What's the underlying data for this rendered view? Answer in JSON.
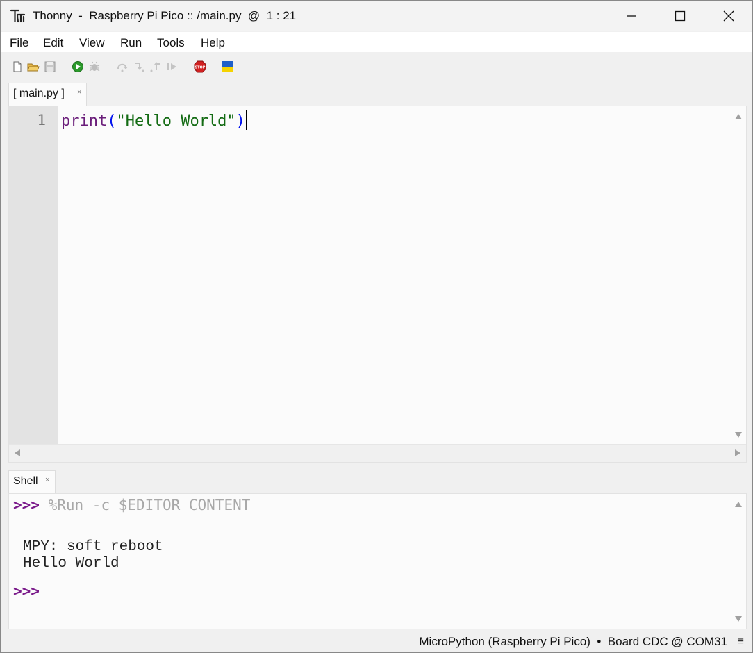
{
  "window": {
    "title": "Thonny  -  Raspberry Pi Pico :: /main.py  @  1 : 21"
  },
  "menu": {
    "items": [
      "File",
      "Edit",
      "View",
      "Run",
      "Tools",
      "Help"
    ]
  },
  "toolbar": {
    "icons": [
      "new-file-icon",
      "open-file-icon",
      "save-icon",
      "run-icon",
      "debug-icon",
      "step-over-icon",
      "step-into-icon",
      "step-out-icon",
      "resume-icon",
      "stop-icon",
      "ukraine-flag-icon"
    ],
    "colors": {
      "run": "#2b9a2b",
      "stop": "#d22020",
      "flag_blue": "#1f5fc8",
      "flag_yellow": "#f5d300"
    }
  },
  "editor": {
    "tab_label": "[ main.py ]",
    "tab_close": "×",
    "line_number": "1",
    "code": {
      "keyword": "print",
      "open_paren": "(",
      "string": "\"Hello World\"",
      "close_paren": ")"
    }
  },
  "shell": {
    "tab_label": "Shell",
    "tab_close": "×",
    "prompt": ">>>",
    "command": "%Run -c $EDITOR_CONTENT",
    "output": [
      "MPY: soft reboot",
      "Hello World"
    ]
  },
  "status": {
    "interpreter": "MicroPython (Raspberry Pi Pico)  •  Board CDC @ COM31",
    "menu_glyph": "≡"
  }
}
